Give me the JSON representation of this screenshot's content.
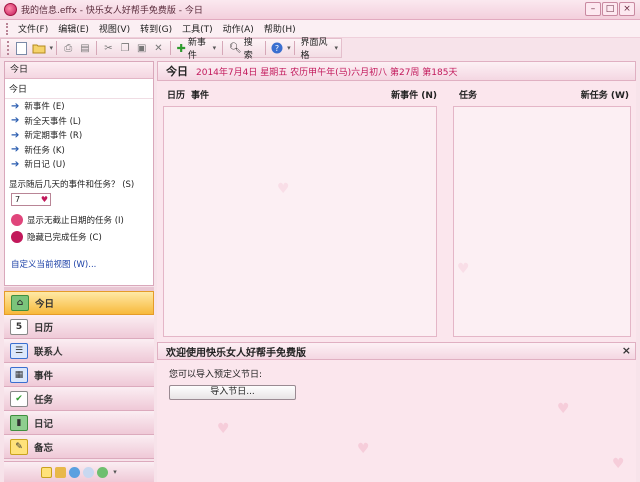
{
  "window": {
    "title": "我的信息.effx - 快乐女人好帮手免费版 - 今日",
    "min": "–",
    "max": "□",
    "close": "×"
  },
  "menu": [
    "文件(F)",
    "编辑(E)",
    "视图(V)",
    "转到(G)",
    "工具(T)",
    "动作(A)",
    "帮助(H)"
  ],
  "toolbar": {
    "new_event": "新事件",
    "search": "搜索",
    "skin": "界面风格"
  },
  "left": {
    "header": "今日",
    "today": "今日",
    "links": [
      "新事件 (E)",
      "新全天事件 (L)",
      "新定期事件 (R)",
      "新任务 (K)",
      "新日记 (U)"
    ],
    "days_question": "显示随后几天的事件和任务？ (S)",
    "days_value": "7",
    "check1": "显示无截止日期的任务 (I)",
    "check2": "隐藏已完成任务 (C)",
    "custom_view": "自定义当前视图 (W)..."
  },
  "nav": [
    "今日",
    "日历",
    "联系人",
    "事件",
    "任务",
    "日记",
    "备忘"
  ],
  "main": {
    "date_title": "今日",
    "date_info": "2014年7月4日 星期五 农历甲午年(马)六月初八 第27周 第185天",
    "col1_a": "日历",
    "col1_b": "事件",
    "col1_right": "新事件 (N)",
    "col2": "任务",
    "col2_right": "新任务 (W)",
    "welcome_title": "欢迎使用快乐女人好帮手免费版",
    "welcome_text": "您可以导入预定义节日:",
    "import_button": "导入节日..."
  },
  "colors": {
    "accent": "#c2185b",
    "active_nav": "#f7b93c",
    "background": "#f7e3ea"
  }
}
